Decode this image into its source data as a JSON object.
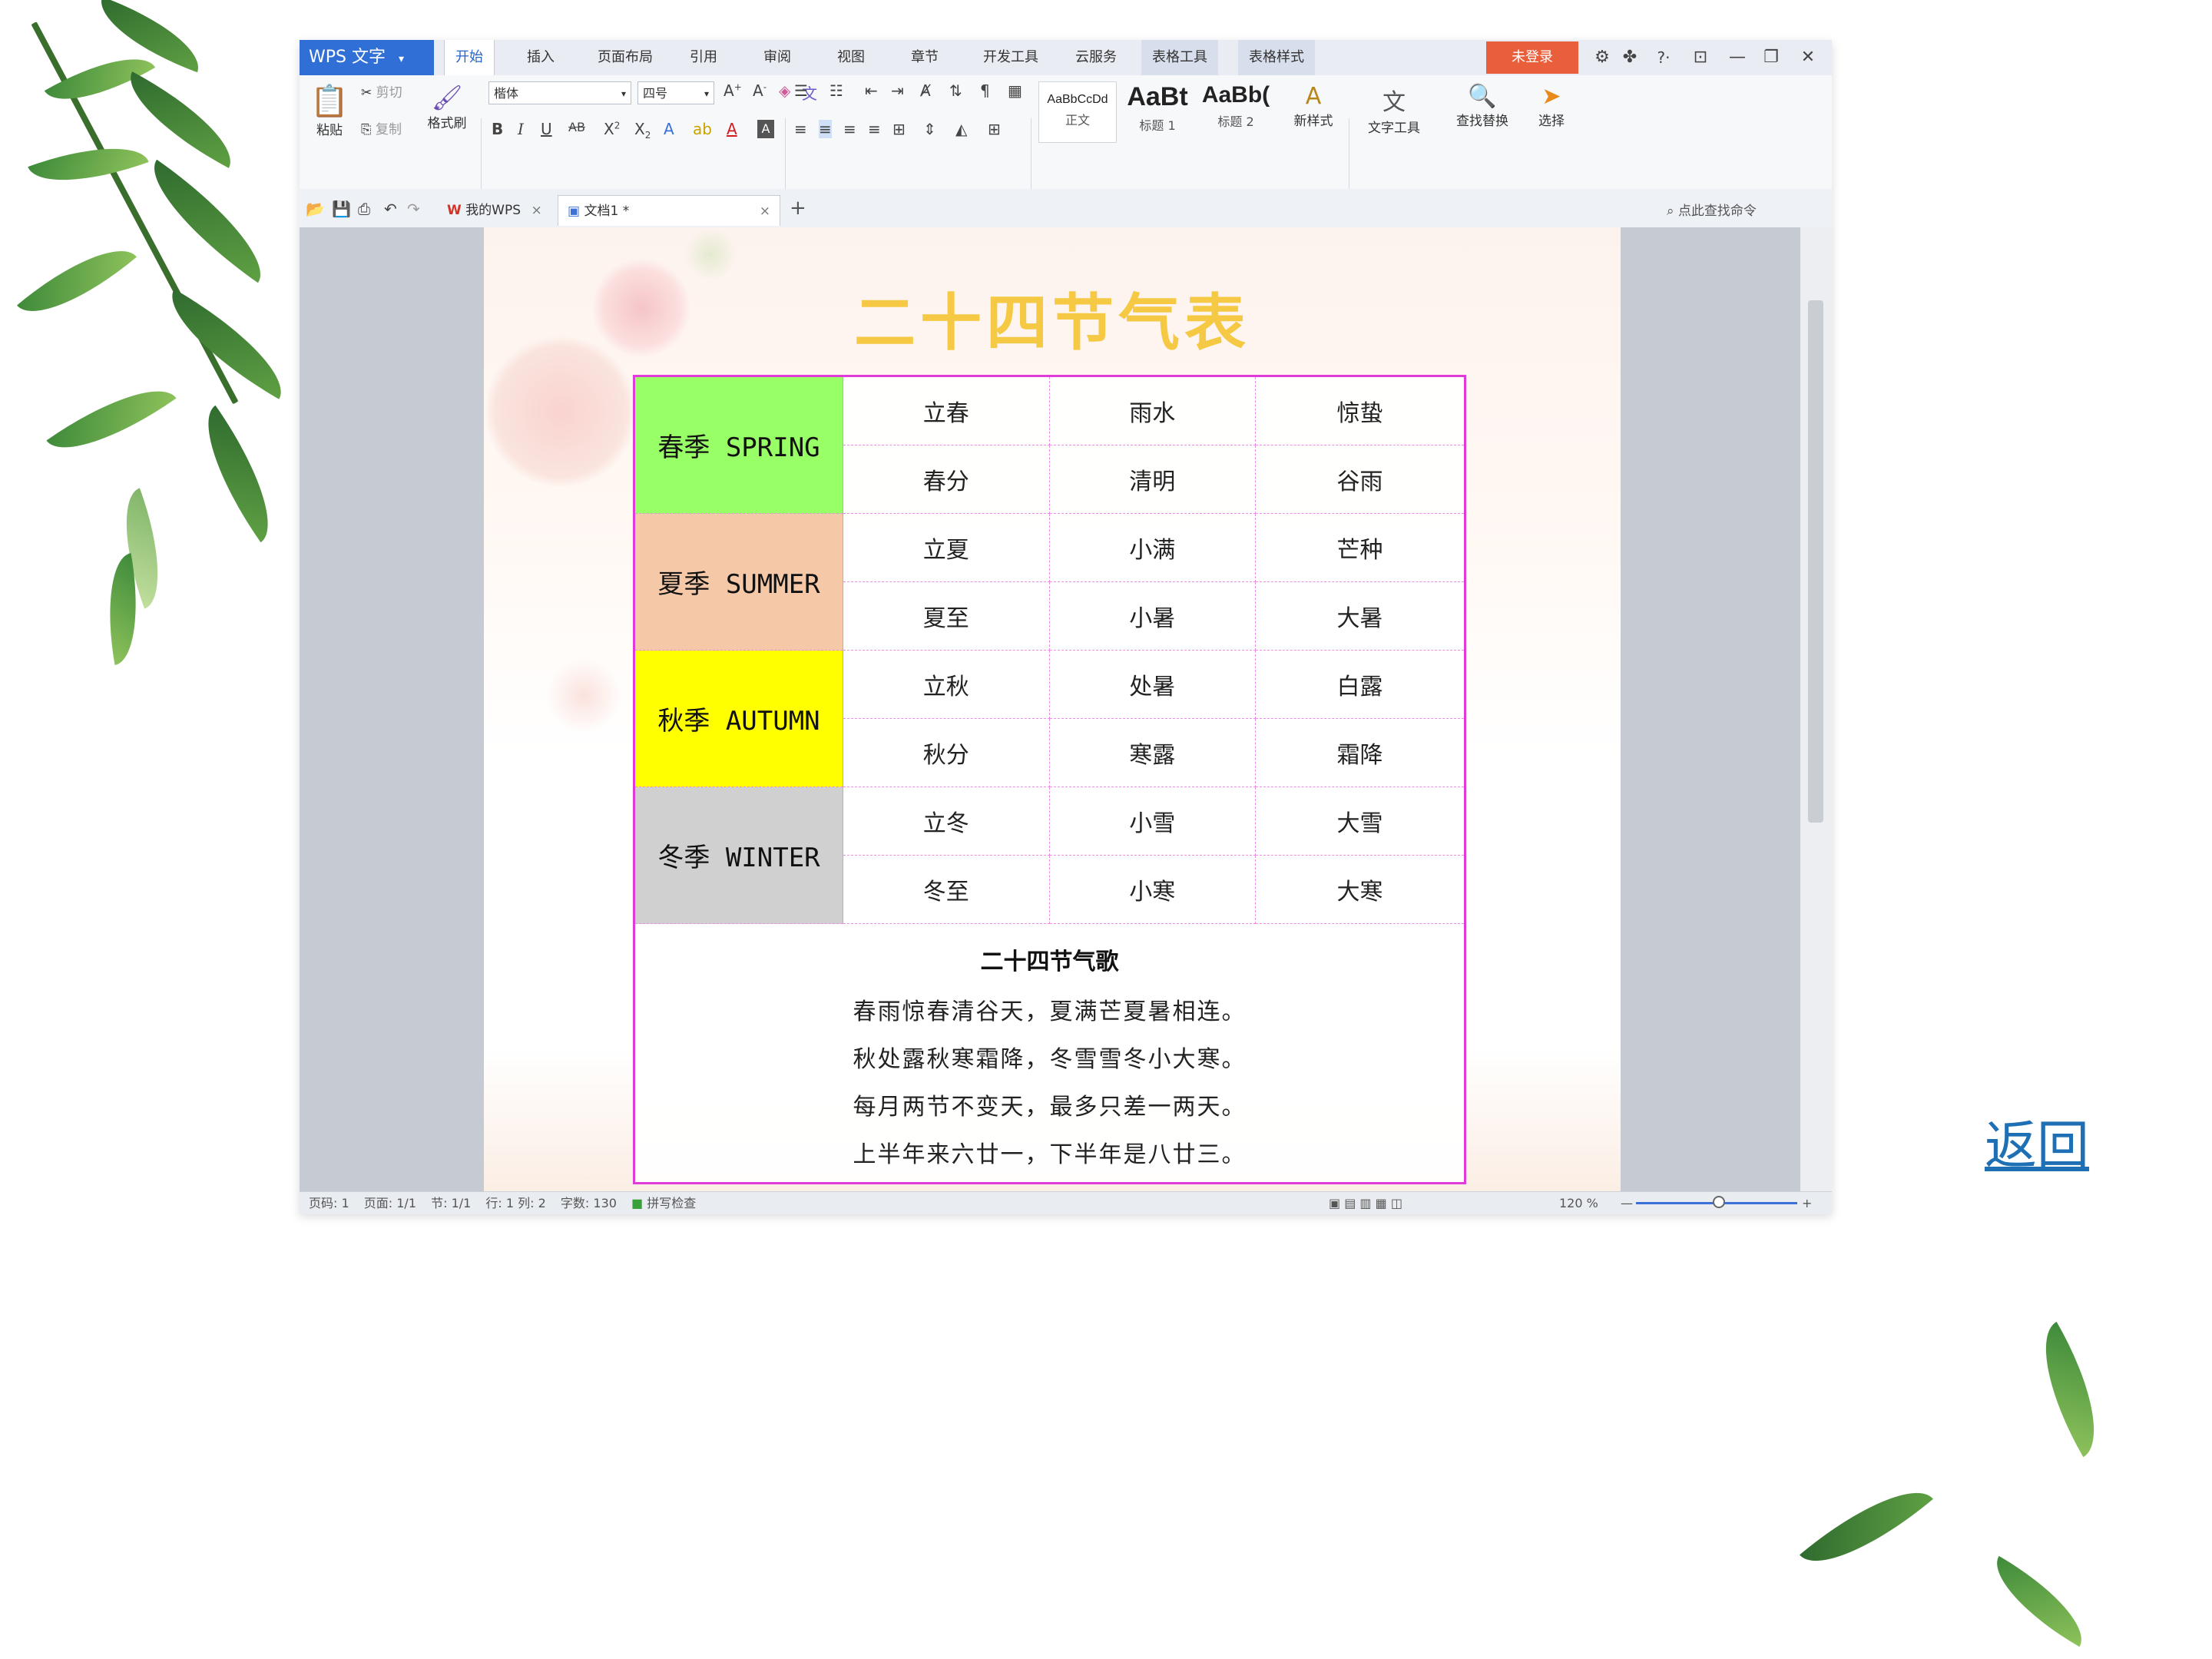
{
  "app": {
    "logo": "WPS 文字",
    "menu_tabs": [
      "开始",
      "插入",
      "页面布局",
      "引用",
      "审阅",
      "视图",
      "章节",
      "开发工具",
      "云服务",
      "表格工具",
      "表格样式"
    ],
    "login": "未登录",
    "help": "?·"
  },
  "ribbon": {
    "paste": "粘贴",
    "cut": "剪切",
    "copy": "复制",
    "format_painter": "格式刷",
    "font_name": "楷体",
    "font_size": "四号",
    "styles": [
      {
        "sample": "AaBbCcDd",
        "name": "正文"
      },
      {
        "sample": "AaBt",
        "name": "标题 1"
      },
      {
        "sample": "AaBb(",
        "name": "标题 2"
      }
    ],
    "new_style": "新样式",
    "text_tools": "文字工具",
    "find_replace": "查找替换",
    "select": "选择"
  },
  "tabs": {
    "my_wps": "我的WPS",
    "doc_tab": "文档1 *",
    "search_cmd": "点此查找命令"
  },
  "document": {
    "title": "二十四节气表",
    "seasons": [
      {
        "name": "春季 SPRING",
        "color": "#99ff66",
        "terms": [
          [
            "立春",
            "雨水",
            "惊蛰"
          ],
          [
            "春分",
            "清明",
            "谷雨"
          ]
        ]
      },
      {
        "name": "夏季 SUMMER",
        "color": "#f5c8a8",
        "terms": [
          [
            "立夏",
            "小满",
            "芒种"
          ],
          [
            "夏至",
            "小暑",
            "大暑"
          ]
        ]
      },
      {
        "name": "秋季 AUTUMN",
        "color": "#ffff00",
        "terms": [
          [
            "立秋",
            "处暑",
            "白露"
          ],
          [
            "秋分",
            "寒露",
            "霜降"
          ]
        ]
      },
      {
        "name": "冬季 WINTER",
        "color": "#d0d0d0",
        "terms": [
          [
            "立冬",
            "小雪",
            "大雪"
          ],
          [
            "冬至",
            "小寒",
            "大寒"
          ]
        ]
      }
    ],
    "poem_title": "二十四节气歌",
    "poem_lines": [
      "春雨惊春清谷天，夏满芒夏暑相连。",
      "秋处露秋寒霜降，冬雪雪冬小大寒。",
      "每月两节不变天，最多只差一两天。",
      "上半年来六廿一，下半年是八廿三。"
    ]
  },
  "status": {
    "page_no": "页码: 1",
    "pages": "页面: 1/1",
    "section": "节: 1/1",
    "row_col": "行: 1  列: 2",
    "word_count": "字数: 130",
    "spell": "拼写检查",
    "zoom": "120 %"
  },
  "return_link": "返回"
}
